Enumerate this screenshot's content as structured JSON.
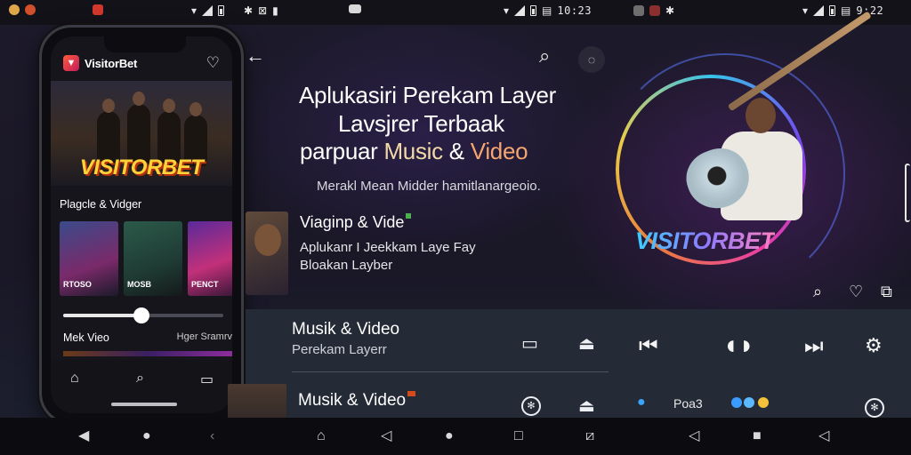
{
  "status_bar": {
    "time_center": "10:23",
    "time_right": "9:22"
  },
  "phone": {
    "app_name": "VisitorBet",
    "hero_title": "VISITORBET",
    "section_title": "Plagcle & Vidger",
    "thumbnails": [
      {
        "caption": "RTOSO"
      },
      {
        "caption": "MOSB"
      },
      {
        "caption": "PENCT"
      }
    ],
    "slider_value_percent": 49,
    "row_label": "Mek Vieo",
    "row_right": "Hger Sramrv"
  },
  "main": {
    "heading_line1": "Aplukasiri Perekam Layer",
    "heading_line2": "Lavsjrer Terbaak",
    "heading_line3_prefix": "parpuar ",
    "heading_line3_accent1": "Music",
    "heading_line3_amp": " & ",
    "heading_line3_accent2": "Video",
    "subheading": "Merakl Mean Midder hamitlanargeoio.",
    "card": {
      "title": "Viaginp & Vide",
      "line1": "Aplukanr I Jeekkam Laye Fay",
      "line2": "Bloakan Layber"
    },
    "brand_logo": "VISITORBET"
  },
  "player": {
    "title": "Musik & Video",
    "subtitle": "Perekam Layerr",
    "title2": "Musik & Video",
    "pod_label": "Poa3"
  },
  "colors": {
    "accent_orange": "#f5a56f",
    "accent_yellow": "#ffd23a",
    "panel_bg": "#242b36",
    "ring_cyan": "#3ad6ff",
    "ring_pink": "#ff3fb5"
  }
}
